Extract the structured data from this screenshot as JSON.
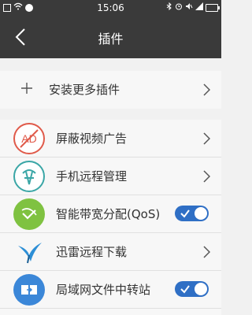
{
  "status": {
    "time": "15:06"
  },
  "header": {
    "title": "插件"
  },
  "add_more": {
    "label": "安装更多插件"
  },
  "plugins": [
    {
      "label": "屏蔽视频广告",
      "icon": "ad-block-icon",
      "control": "chevron"
    },
    {
      "label": "手机远程管理",
      "icon": "remote-manage-icon",
      "control": "chevron"
    },
    {
      "label": "智能带宽分配(QoS)",
      "icon": "bandwidth-qos-icon",
      "control": "toggle",
      "enabled": true
    },
    {
      "label": "迅雷远程下载",
      "icon": "thunder-bird-icon",
      "control": "chevron"
    },
    {
      "label": "局域网文件中转站",
      "icon": "file-transfer-icon",
      "control": "toggle",
      "enabled": true
    }
  ],
  "colors": {
    "header_bg": "#3a3a3a",
    "toggle_on": "#2f6fc5",
    "qos_green": "#7fc241",
    "adblock_red": "#e05a4a"
  }
}
